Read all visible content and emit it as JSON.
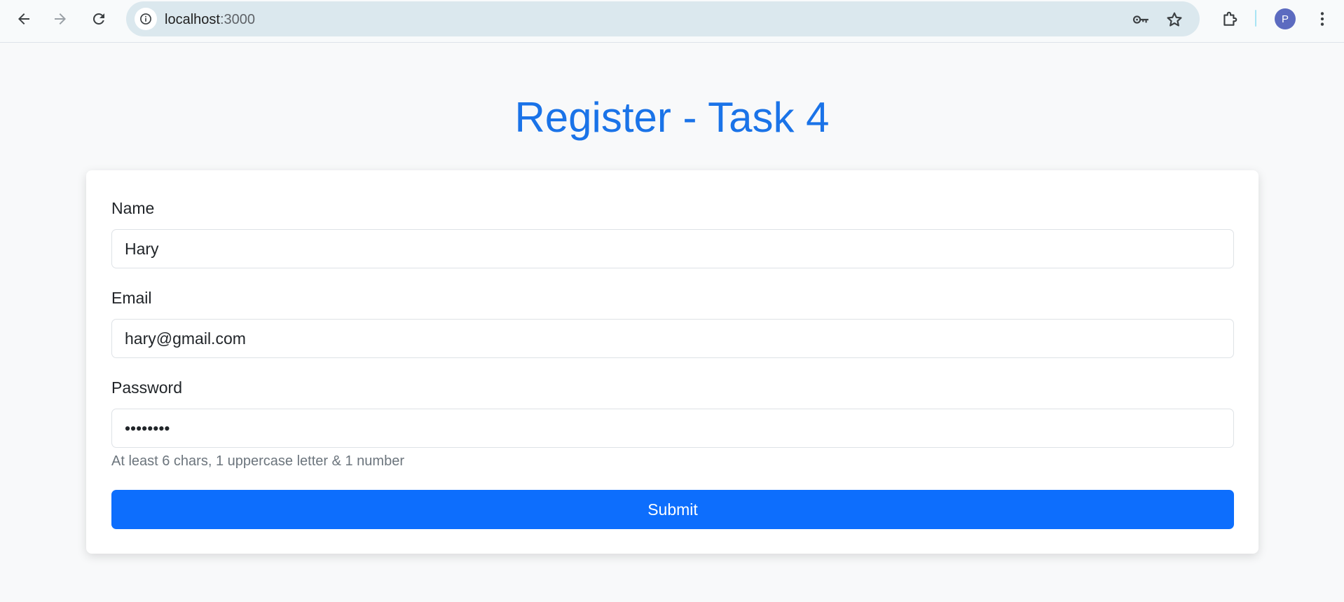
{
  "browser": {
    "url_host": "localhost",
    "url_port": ":3000",
    "profile_initial": "P",
    "icons": {
      "back": "arrow-left-icon",
      "forward": "arrow-right-icon",
      "reload": "reload-icon",
      "site_info": "info-icon",
      "passwords": "key-icon",
      "bookmark": "star-icon",
      "extensions": "puzzle-icon",
      "menu": "kebab-menu-icon"
    }
  },
  "page": {
    "title": "Register - Task 4"
  },
  "form": {
    "name": {
      "label": "Name",
      "value": "Hary"
    },
    "email": {
      "label": "Email",
      "value": "hary@gmail.com"
    },
    "password": {
      "label": "Password",
      "value": "12345678",
      "hint": "At least 6 chars, 1 uppercase letter & 1 number"
    },
    "submit_label": "Submit"
  },
  "colors": {
    "title": "#1a73e8",
    "button": "#0d6efd",
    "avatar": "#5c6bc0",
    "omnibox": "#dbe8ee"
  }
}
